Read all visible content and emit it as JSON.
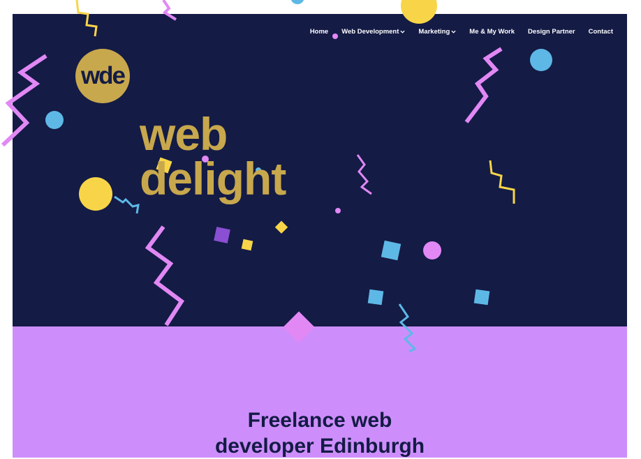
{
  "nav": {
    "items": [
      {
        "label": "Home",
        "has_dropdown": false
      },
      {
        "label": "Web Development",
        "has_dropdown": true
      },
      {
        "label": "Marketing",
        "has_dropdown": true
      },
      {
        "label": "Me & My Work",
        "has_dropdown": false
      },
      {
        "label": "Design Partner",
        "has_dropdown": false
      },
      {
        "label": "Contact",
        "has_dropdown": false
      }
    ]
  },
  "logo": {
    "text": "wde"
  },
  "hero": {
    "headline_line1": "web",
    "headline_line2": "delight"
  },
  "intro": {
    "heading_line1": "Freelance web",
    "heading_line2": "developer Edinburgh"
  },
  "colors": {
    "navy": "#141b45",
    "gold": "#c8a84d",
    "lilac": "#cd8efc",
    "pink": "#e188f5",
    "yellow": "#f8d548",
    "blue": "#5eb8e6",
    "purple": "#8a4fd2"
  }
}
